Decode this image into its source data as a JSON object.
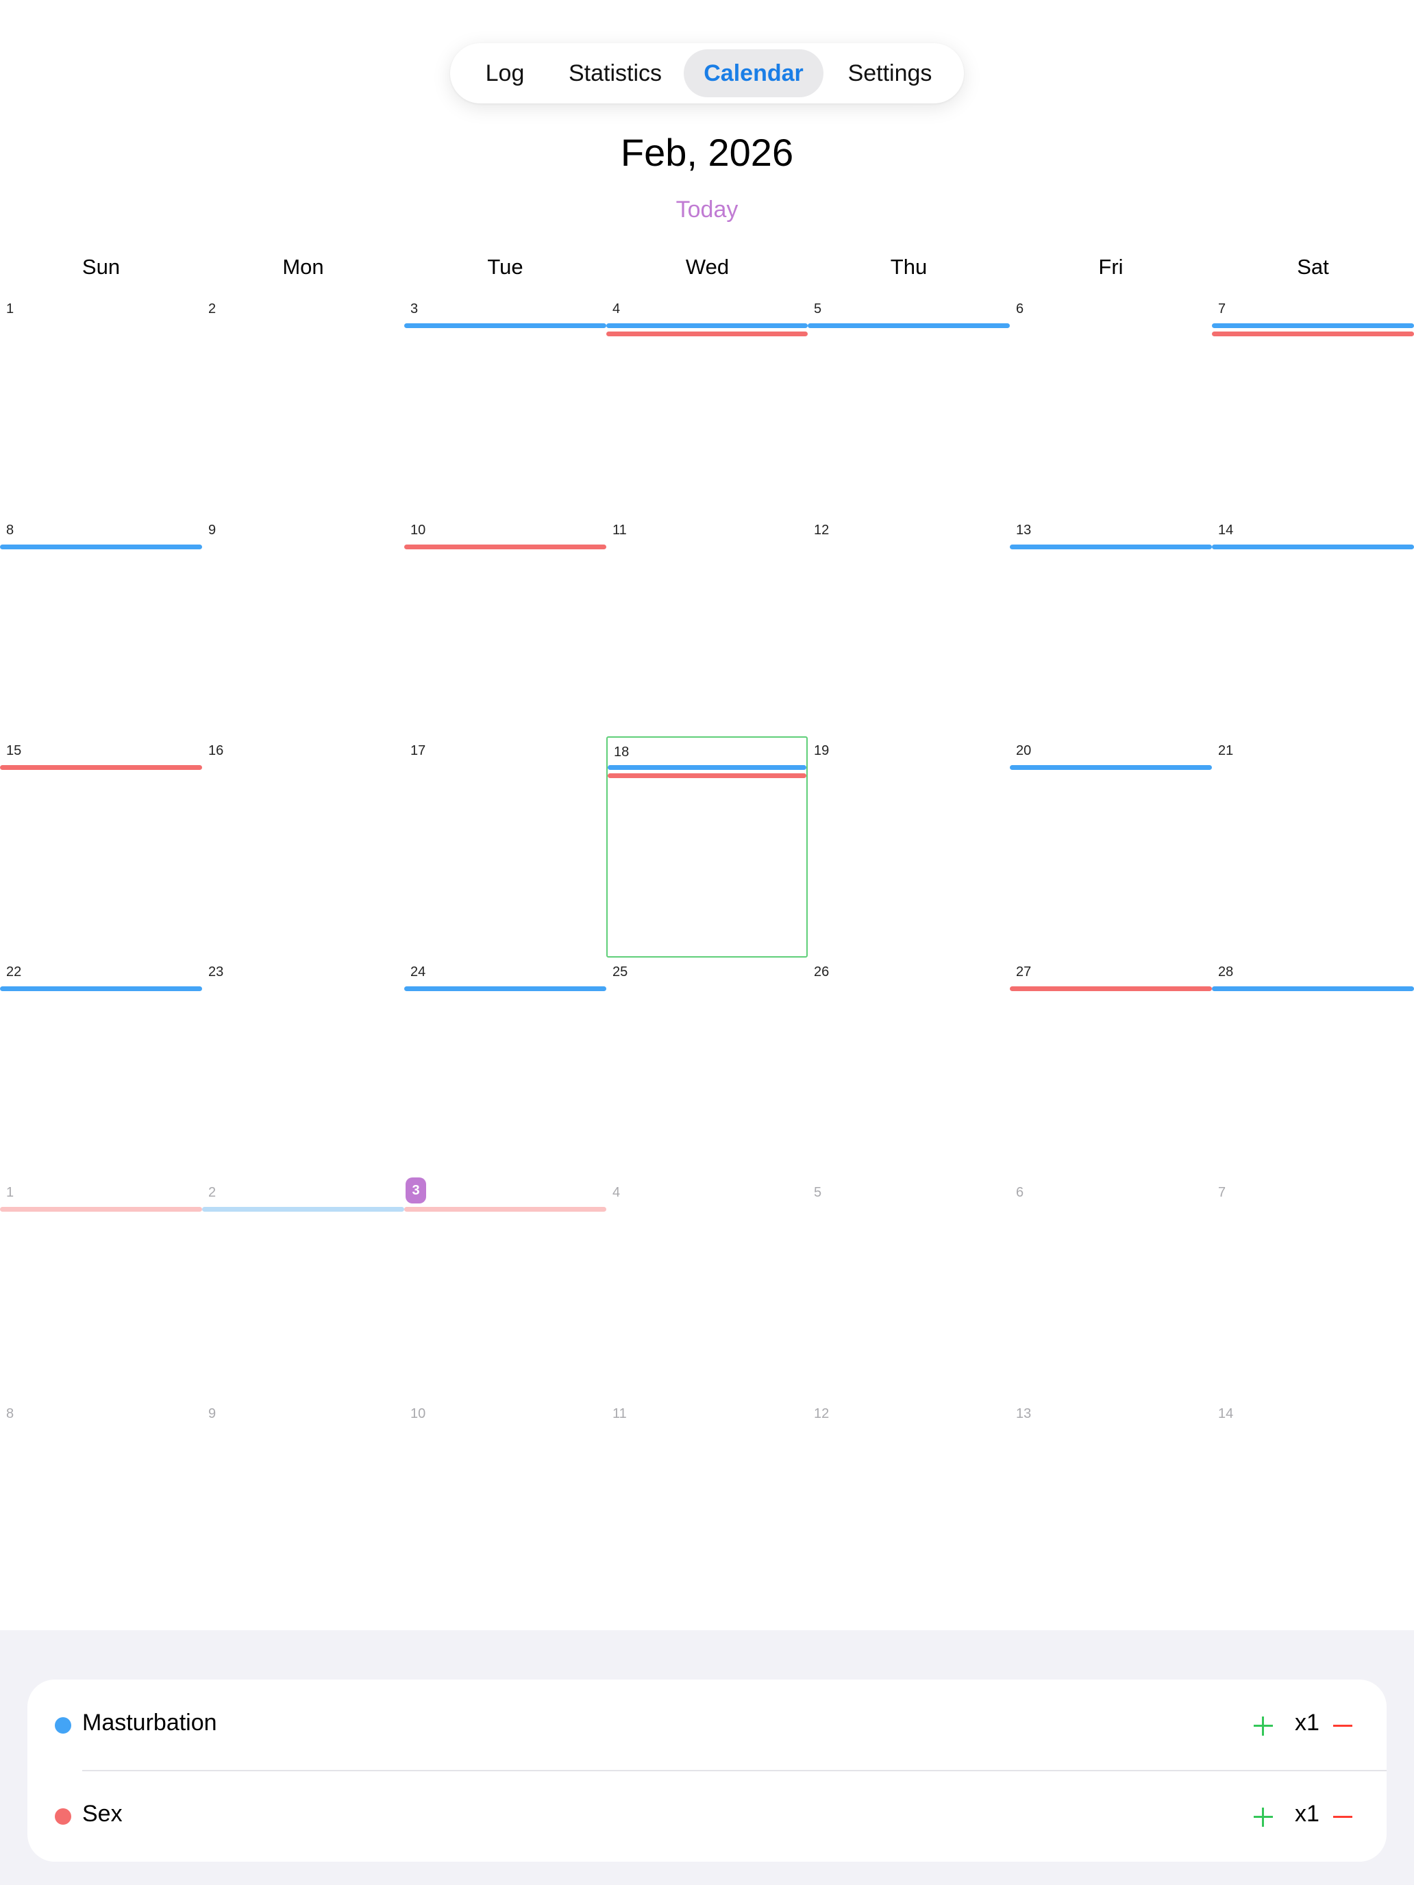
{
  "nav": {
    "tabs": [
      {
        "label": "Log",
        "active": false
      },
      {
        "label": "Statistics",
        "active": false
      },
      {
        "label": "Calendar",
        "active": true
      },
      {
        "label": "Settings",
        "active": false
      }
    ]
  },
  "calendar": {
    "month_title": "Feb, 2026",
    "today_label": "Today",
    "weekdays": [
      "Sun",
      "Mon",
      "Tue",
      "Wed",
      "Thu",
      "Fri",
      "Sat"
    ],
    "selected_day": "18",
    "today_day": "3",
    "weeks": [
      [
        {
          "day": "1",
          "in_month": true,
          "events": []
        },
        {
          "day": "2",
          "in_month": true,
          "events": []
        },
        {
          "day": "3",
          "in_month": true,
          "events": [
            "masturbation"
          ]
        },
        {
          "day": "4",
          "in_month": true,
          "events": [
            "masturbation",
            "sex"
          ]
        },
        {
          "day": "5",
          "in_month": true,
          "events": [
            "masturbation"
          ]
        },
        {
          "day": "6",
          "in_month": true,
          "events": []
        },
        {
          "day": "7",
          "in_month": true,
          "events": [
            "masturbation",
            "sex"
          ]
        }
      ],
      [
        {
          "day": "8",
          "in_month": true,
          "events": [
            "masturbation"
          ]
        },
        {
          "day": "9",
          "in_month": true,
          "events": []
        },
        {
          "day": "10",
          "in_month": true,
          "events": [
            "sex"
          ]
        },
        {
          "day": "11",
          "in_month": true,
          "events": []
        },
        {
          "day": "12",
          "in_month": true,
          "events": []
        },
        {
          "day": "13",
          "in_month": true,
          "events": [
            "masturbation"
          ]
        },
        {
          "day": "14",
          "in_month": true,
          "events": [
            "masturbation"
          ]
        }
      ],
      [
        {
          "day": "15",
          "in_month": true,
          "events": [
            "sex"
          ]
        },
        {
          "day": "16",
          "in_month": true,
          "events": []
        },
        {
          "day": "17",
          "in_month": true,
          "events": []
        },
        {
          "day": "18",
          "in_month": true,
          "events": [
            "masturbation",
            "sex"
          ],
          "selected": true
        },
        {
          "day": "19",
          "in_month": true,
          "events": []
        },
        {
          "day": "20",
          "in_month": true,
          "events": [
            "masturbation"
          ]
        },
        {
          "day": "21",
          "in_month": true,
          "events": []
        }
      ],
      [
        {
          "day": "22",
          "in_month": true,
          "events": [
            "masturbation"
          ]
        },
        {
          "day": "23",
          "in_month": true,
          "events": []
        },
        {
          "day": "24",
          "in_month": true,
          "events": [
            "masturbation"
          ]
        },
        {
          "day": "25",
          "in_month": true,
          "events": []
        },
        {
          "day": "26",
          "in_month": true,
          "events": []
        },
        {
          "day": "27",
          "in_month": true,
          "events": [
            "sex"
          ]
        },
        {
          "day": "28",
          "in_month": true,
          "events": [
            "masturbation"
          ]
        }
      ],
      [
        {
          "day": "1",
          "in_month": false,
          "events": [
            "sex"
          ]
        },
        {
          "day": "2",
          "in_month": false,
          "events": [
            "masturbation"
          ]
        },
        {
          "day": "3",
          "in_month": false,
          "events": [
            "sex"
          ],
          "today": true
        },
        {
          "day": "4",
          "in_month": false,
          "events": []
        },
        {
          "day": "5",
          "in_month": false,
          "events": []
        },
        {
          "day": "6",
          "in_month": false,
          "events": []
        },
        {
          "day": "7",
          "in_month": false,
          "events": []
        }
      ],
      [
        {
          "day": "8",
          "in_month": false,
          "events": []
        },
        {
          "day": "9",
          "in_month": false,
          "events": []
        },
        {
          "day": "10",
          "in_month": false,
          "events": []
        },
        {
          "day": "11",
          "in_month": false,
          "events": []
        },
        {
          "day": "12",
          "in_month": false,
          "events": []
        },
        {
          "day": "13",
          "in_month": false,
          "events": []
        },
        {
          "day": "14",
          "in_month": false,
          "events": []
        }
      ]
    ]
  },
  "activities": [
    {
      "id": "masturbation",
      "label": "Masturbation",
      "count": "x1",
      "color": "#43a4f6",
      "color_faded": "#b9dcf7"
    },
    {
      "id": "sex",
      "label": "Sex",
      "count": "x1",
      "color": "#f46e6e",
      "color_faded": "#fbc3c3"
    }
  ],
  "colors": {
    "accent": "#1a7ee6",
    "today": "#c07bd3",
    "selected_border": "#5fcf79",
    "plus": "#34c759",
    "minus": "#ff3b30"
  }
}
